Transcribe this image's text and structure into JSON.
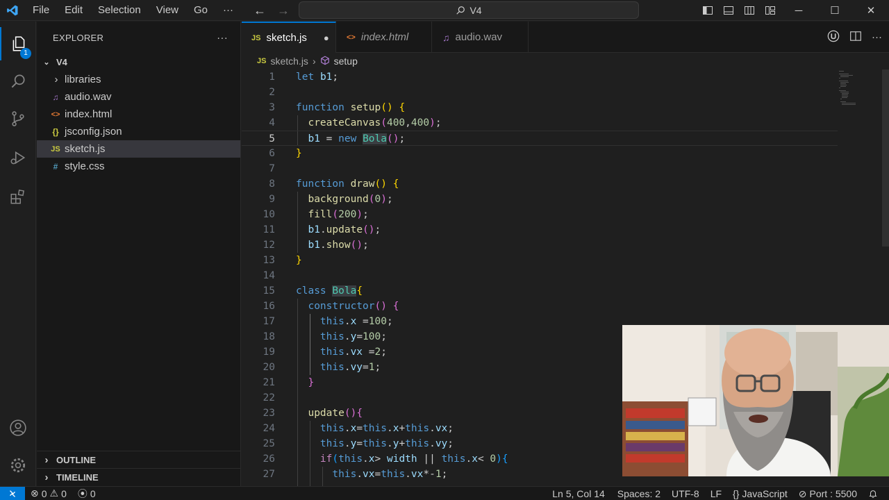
{
  "menu": [
    "File",
    "Edit",
    "Selection",
    "View",
    "Go"
  ],
  "menu_more": "···",
  "command_center": "V4",
  "explorer": {
    "title": "EXPLORER",
    "more": "···",
    "root": "V4",
    "items": [
      {
        "name": "libraries",
        "icon": "folder-chevron-icon",
        "glyph": "›"
      },
      {
        "name": "audio.wav",
        "icon": "audio-file-icon",
        "glyph": "♫"
      },
      {
        "name": "index.html",
        "icon": "html-file-icon",
        "glyph": "<>"
      },
      {
        "name": "jsconfig.json",
        "icon": "json-file-icon",
        "glyph": "{}"
      },
      {
        "name": "sketch.js",
        "icon": "js-file-icon",
        "glyph": "JS"
      },
      {
        "name": "style.css",
        "icon": "css-file-icon",
        "glyph": "#"
      }
    ],
    "outline": "OUTLINE",
    "timeline": "TIMELINE"
  },
  "activity_badge": "1",
  "tabs": [
    {
      "label": "sketch.js",
      "icon": "JS",
      "modified": "●"
    },
    {
      "label": "index.html",
      "icon": "<>"
    },
    {
      "label": "audio.wav",
      "icon": "♫"
    }
  ],
  "breadcrumb": {
    "file": "sketch.js",
    "symbol": "setup"
  },
  "code_lines": [
    "let b1;",
    "",
    "function setup() {",
    "  createCanvas(400,400);",
    "  b1 = new Bola();",
    "}",
    "",
    "function draw() {",
    "  background(0);",
    "  fill(200);",
    "  b1.update();",
    "  b1.show();",
    "}",
    "",
    "class Bola{",
    "  constructor() {",
    "    this.x =100;",
    "    this.y=100;",
    "    this.vx =2;",
    "    this.vy=1;",
    "  }",
    "",
    "  update(){",
    "    this.x=this.x+this.vx;",
    "    this.y=this.y+this.vy;",
    "    if(this.x> width || this.x< 0){",
    "      this.vx=this.vx*-1;"
  ],
  "current_line": 5,
  "status": {
    "errors": "0",
    "warnings": "0",
    "ports": "0",
    "position": "Ln 5, Col 14",
    "spaces": "Spaces: 2",
    "encoding": "UTF-8",
    "eol": "LF",
    "language": "JavaScript",
    "port": "Port : 5500"
  },
  "colors": {
    "accent": "#0078d4",
    "keyword": "#569cd6",
    "function": "#dcdcaa",
    "number": "#b5cea8",
    "class": "#4ec9b0",
    "variable": "#9cdcfe"
  }
}
